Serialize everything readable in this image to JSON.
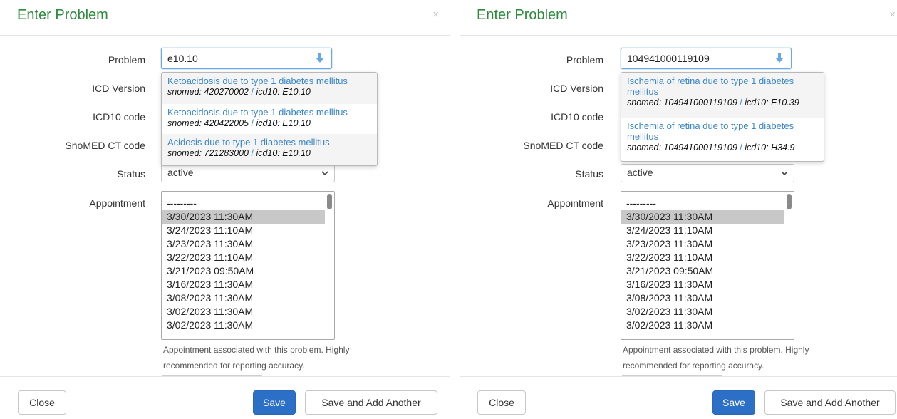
{
  "colors": {
    "title": "#2e8b3d",
    "primary": "#2c6fc7",
    "link": "#3a86c8"
  },
  "labels": {
    "problem": "Problem",
    "icd_version": "ICD Version",
    "icd10_code": "ICD10 code",
    "snomed_code": "SnoMED CT code",
    "status": "Status",
    "appointment": "Appointment"
  },
  "help": {
    "line1": "Appointment associated with this problem. Highly",
    "line2": "recommended for reporting accuracy."
  },
  "buttons": {
    "close": "Close",
    "save": "Save",
    "save_add": "Save and Add Another"
  },
  "appointments": [
    "---------",
    "3/30/2023 11:30AM",
    "3/24/2023 11:10AM",
    "3/23/2023 11:30AM",
    "3/22/2023 11:10AM",
    "3/21/2023 09:50AM",
    "3/16/2023 11:30AM",
    "3/08/2023 11:30AM",
    "3/02/2023 11:30AM",
    "3/02/2023 11:30AM"
  ],
  "left": {
    "title": "Enter Problem",
    "close_glyph": "×",
    "problem_value": "e10.10",
    "status_value": "active",
    "selected_appointment": "3/30/2023 11:30AM",
    "suggestions": [
      {
        "title": "Ketoacidosis due to type 1 diabetes mellitus",
        "snomed": "snomed: 420270002",
        "sep": "/",
        "icd": "icd10: E10.10"
      },
      {
        "title": "Ketoacidosis due to type 1 diabetes mellitus",
        "snomed": "snomed: 420422005",
        "sep": "/",
        "icd": "icd10: E10.10"
      },
      {
        "title": "Acidosis due to type 1 diabetes mellitus",
        "snomed": "snomed: 721283000",
        "sep": "/",
        "icd": "icd10: E10.10"
      }
    ]
  },
  "right": {
    "title": "Enter Problem",
    "close_glyph": "×",
    "problem_value": "104941000119109",
    "status_value": "active",
    "selected_appointment": "3/30/2023 11:30AM",
    "suggestions": [
      {
        "title_line1": "Ischemia of retina due to type 1 diabetes",
        "title_line2": "mellitus",
        "snomed": "snomed: 104941000119109",
        "sep": "/",
        "icd": "icd10: E10.39"
      },
      {
        "title_line1": "Ischemia of retina due to type 1 diabetes",
        "title_line2": "mellitus",
        "snomed": "snomed: 104941000119109",
        "sep": "/",
        "icd": "icd10: H34.9"
      }
    ]
  }
}
